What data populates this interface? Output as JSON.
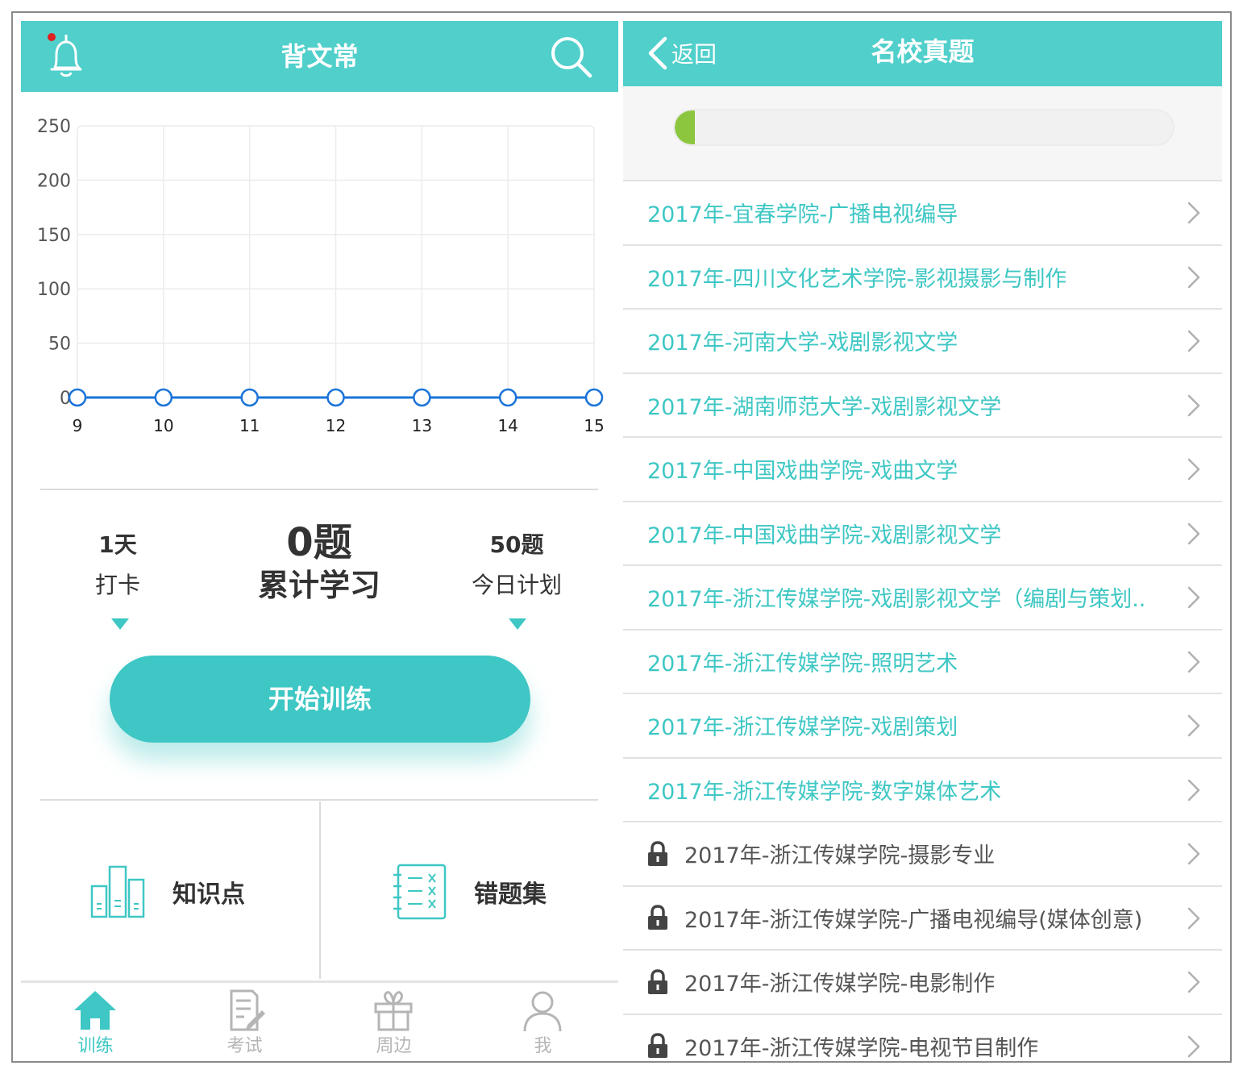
{
  "left": {
    "header": {
      "title": "背文常"
    },
    "stats": {
      "days_value": "1天",
      "days_label": "打卡",
      "total_value": "0题",
      "total_label": "累计学习",
      "plan_value": "50题",
      "plan_label": "今日计划"
    },
    "start_button": "开始训练",
    "tools": {
      "knowledge": "知识点",
      "wrong": "错题集"
    },
    "tabs": [
      {
        "label": "训练",
        "icon": "home-icon"
      },
      {
        "label": "考试",
        "icon": "exam-icon"
      },
      {
        "label": "周边",
        "icon": "gift-icon"
      },
      {
        "label": "我",
        "icon": "user-icon"
      }
    ]
  },
  "chart_data": {
    "type": "line",
    "x": [
      9,
      10,
      11,
      12,
      13,
      14,
      15
    ],
    "series": [
      {
        "values": [
          0,
          0,
          0,
          0,
          0,
          0,
          0
        ]
      }
    ],
    "y_ticks": [
      0,
      50,
      100,
      150,
      200,
      250
    ],
    "ylim": [
      0,
      250
    ],
    "grid": true,
    "colors": {
      "line": "#1a73d8",
      "grid": "#ececec",
      "label": "#555555"
    }
  },
  "right": {
    "header": {
      "back": "返回",
      "title": "名校真题"
    },
    "progress": 0.04,
    "colors": {
      "accent": "#3ec7c4",
      "header": "#50cfcb",
      "progress": "#8cc63f"
    },
    "items": [
      {
        "text": "2017年-宜春学院-广播电视编导",
        "locked": false
      },
      {
        "text": "2017年-四川文化艺术学院-影视摄影与制作",
        "locked": false
      },
      {
        "text": "2017年-河南大学-戏剧影视文学",
        "locked": false
      },
      {
        "text": "2017年-湖南师范大学-戏剧影视文学",
        "locked": false
      },
      {
        "text": "2017年-中国戏曲学院-戏曲文学",
        "locked": false
      },
      {
        "text": "2017年-中国戏曲学院-戏剧影视文学",
        "locked": false
      },
      {
        "text": "2017年-浙江传媒学院-戏剧影视文学（编剧与策划...",
        "locked": false
      },
      {
        "text": "2017年-浙江传媒学院-照明艺术",
        "locked": false
      },
      {
        "text": "2017年-浙江传媒学院-戏剧策划",
        "locked": false
      },
      {
        "text": "2017年-浙江传媒学院-数字媒体艺术",
        "locked": false
      },
      {
        "text": "2017年-浙江传媒学院-摄影专业",
        "locked": true
      },
      {
        "text": "2017年-浙江传媒学院-广播电视编导(媒体创意)",
        "locked": true
      },
      {
        "text": "2017年-浙江传媒学院-电影制作",
        "locked": true
      },
      {
        "text": "2017年-浙江传媒学院-电视节目制作",
        "locked": true
      }
    ]
  }
}
